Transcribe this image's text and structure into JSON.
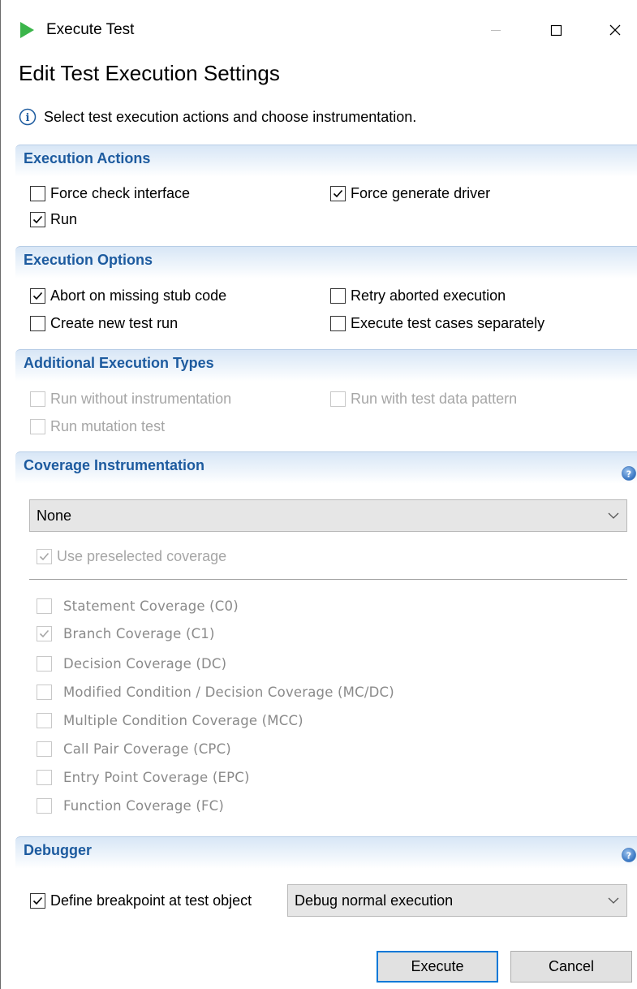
{
  "window": {
    "title": "Execute Test",
    "app_icon": "play-triangle-icon"
  },
  "heading": "Edit Test Execution Settings",
  "info": {
    "icon": "info-icon",
    "text": "Select test execution actions and choose instrumentation."
  },
  "sections": {
    "execution_actions": {
      "title": "Execution Actions",
      "force_check_interface": "Force check interface",
      "force_generate_driver": "Force generate driver",
      "run": "Run"
    },
    "execution_options": {
      "title": "Execution Options",
      "abort_missing_stub": "Abort on missing stub code",
      "retry_aborted": "Retry aborted execution",
      "create_new_run": "Create new test run",
      "execute_separately": "Execute test cases separately"
    },
    "additional_types": {
      "title": "Additional Execution Types",
      "run_without_instr": "Run without instrumentation",
      "run_with_pattern": "Run with test data pattern",
      "run_mutation": "Run mutation test"
    },
    "coverage": {
      "title": "Coverage Instrumentation",
      "select_value": "None",
      "use_preselected": "Use preselected coverage",
      "items": [
        {
          "label": "Statement Coverage (C0)",
          "checked": false
        },
        {
          "label": "Branch Coverage (C1)",
          "checked": true
        },
        {
          "label": "Decision Coverage (DC)",
          "checked": false
        },
        {
          "label": "Modified Condition / Decision Coverage (MC/DC)",
          "checked": false
        },
        {
          "label": "Multiple Condition Coverage (MCC)",
          "checked": false
        },
        {
          "label": "Call Pair Coverage (CPC)",
          "checked": false
        },
        {
          "label": "Entry Point Coverage (EPC)",
          "checked": false
        },
        {
          "label": "Function Coverage (FC)",
          "checked": false
        }
      ]
    },
    "debugger": {
      "title": "Debugger",
      "define_breakpoint": "Define breakpoint at test object",
      "select_value": "Debug normal execution"
    }
  },
  "buttons": {
    "execute": "Execute",
    "cancel": "Cancel"
  },
  "colors": {
    "section_title": "#1d5b9f",
    "primary_border": "#0078d7",
    "play_icon": "#3bb54a"
  }
}
